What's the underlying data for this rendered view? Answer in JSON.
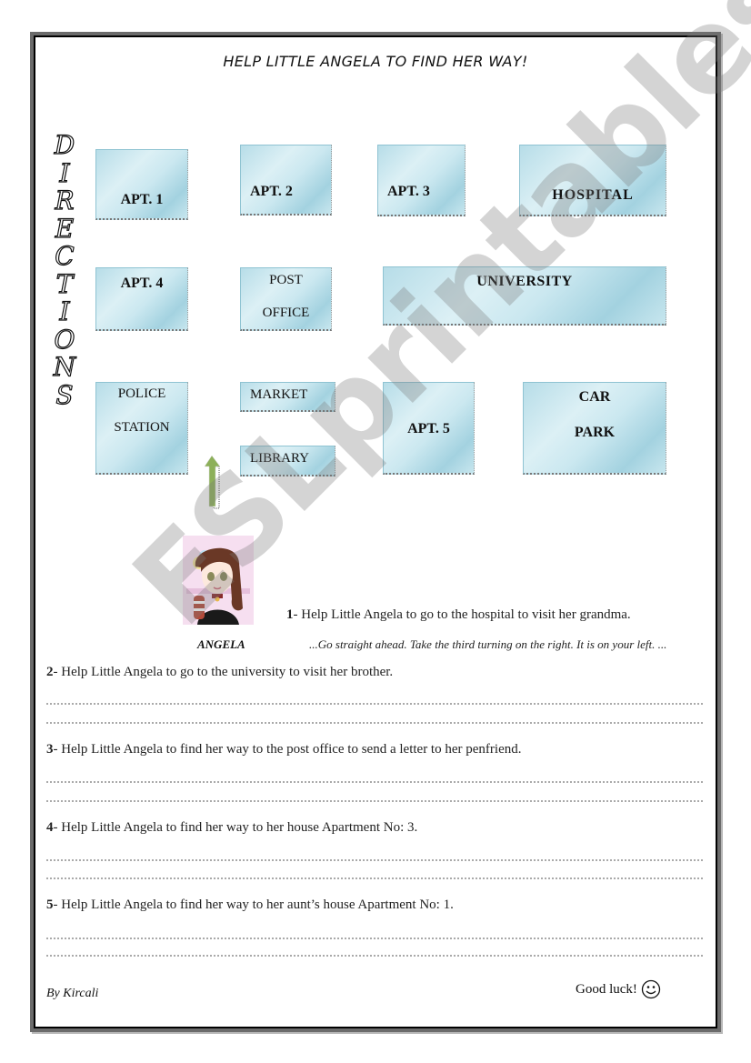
{
  "worksheet": {
    "title": "HELP LITTLE ANGELA TO FIND HER WAY!",
    "side_heading_letters": [
      "D",
      "I",
      "R",
      "E",
      "C",
      "T",
      "I",
      "O",
      "N",
      "S"
    ],
    "map": {
      "places": [
        {
          "id": "apt1",
          "lines": [
            "APT. 1"
          ]
        },
        {
          "id": "apt2",
          "lines": [
            "APT. 2"
          ]
        },
        {
          "id": "apt3",
          "lines": [
            "APT. 3"
          ]
        },
        {
          "id": "hospital",
          "lines": [
            "HOSPITAL"
          ]
        },
        {
          "id": "apt4",
          "lines": [
            "APT. 4"
          ]
        },
        {
          "id": "post-office",
          "lines": [
            "POST",
            "OFFICE"
          ]
        },
        {
          "id": "university",
          "lines": [
            "UNIVERSITY"
          ]
        },
        {
          "id": "police-station",
          "lines": [
            "POLICE",
            "STATION"
          ]
        },
        {
          "id": "market",
          "lines": [
            "MARKET"
          ]
        },
        {
          "id": "library",
          "lines": [
            "LIBRARY"
          ]
        },
        {
          "id": "apt5",
          "lines": [
            "APT. 5"
          ]
        },
        {
          "id": "car-park",
          "lines": [
            "CAR",
            "PARK"
          ]
        }
      ],
      "start_arrow_icon": "up-arrow-icon",
      "arrow_color": "#8db05a",
      "box_color": "#a9d5e2"
    },
    "character": {
      "name_label": "ANGELA",
      "image": "girl-avatar"
    },
    "questions": [
      {
        "number": "1",
        "text": "- Help Little Angela to go to the hospital to visit her grandma.",
        "answer": "...Go straight ahead. Take the third turning on the right. It is on your left. ..."
      },
      {
        "number": "2",
        "text": "- Help Little Angela to go to the university to visit her brother."
      },
      {
        "number": "3",
        "text": "- Help Little Angela to find her way to the post office to send a letter to her penfriend."
      },
      {
        "number": "4",
        "text": "- Help Little Angela to find her way to her house Apartment No: 3."
      },
      {
        "number": "5",
        "text": "- Help Little Angela to find her way to her aunt’s house Apartment No: 1."
      }
    ],
    "footer": {
      "byline": "By Kircali",
      "good_luck": "Good luck!",
      "smiley_icon": "smiley-icon"
    },
    "watermark": "ESLprintables.com"
  }
}
